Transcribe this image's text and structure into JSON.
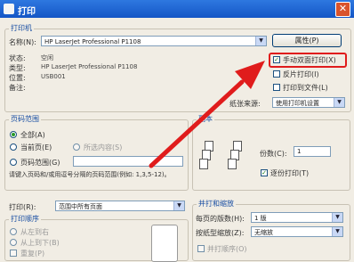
{
  "window": {
    "title": "打印",
    "close_glyph": "✕"
  },
  "printer": {
    "group_title": "打印机",
    "name_label": "名称(N):",
    "name_value": "HP LaserJet Professional P1108",
    "properties_button": "属性(P)",
    "status_label": "状态:",
    "status_value": "空闲",
    "type_label": "类型:",
    "type_value": "HP LaserJet Professional P1108",
    "where_label": "位置:",
    "where_value": "USB001",
    "comment_label": "备注:",
    "manual_duplex": "手动双面打印(X)",
    "print_to_file": "打印到文件(L)",
    "reverse_print": "反片打印(I)",
    "paper_source_label": "纸张来源:",
    "paper_source_value": "使用打印机设置"
  },
  "page_range": {
    "group_title": "页码范围",
    "all": "全部(A)",
    "current": "当前页(E)",
    "selection": "所选内容(S)",
    "pages": "页码范围(G)",
    "hint": "请键入页码和/或用逗号分隔的页码范围(例如: 1,3,5-12)。"
  },
  "copies": {
    "group_title": "副本",
    "count_label": "份数(C):",
    "count_value": "1",
    "collate": "逐份打印(T)"
  },
  "print_what": {
    "label": "打印(R):",
    "value": "范围中所有页面"
  },
  "order": {
    "group_title": "打印顺序",
    "item1": "从左到右",
    "item2": "从上到下(B)",
    "item3": "重复(P)"
  },
  "zoom": {
    "group_title": "并打和缩放",
    "per_sheet_label": "每页的版数(H):",
    "per_sheet_value": "1 版",
    "scale_label": "按纸型缩放(Z):",
    "scale_value": "无缩放",
    "fit_option": "并打顺序(O)"
  },
  "annotation": {
    "arrow_color": "#e01c1c"
  }
}
